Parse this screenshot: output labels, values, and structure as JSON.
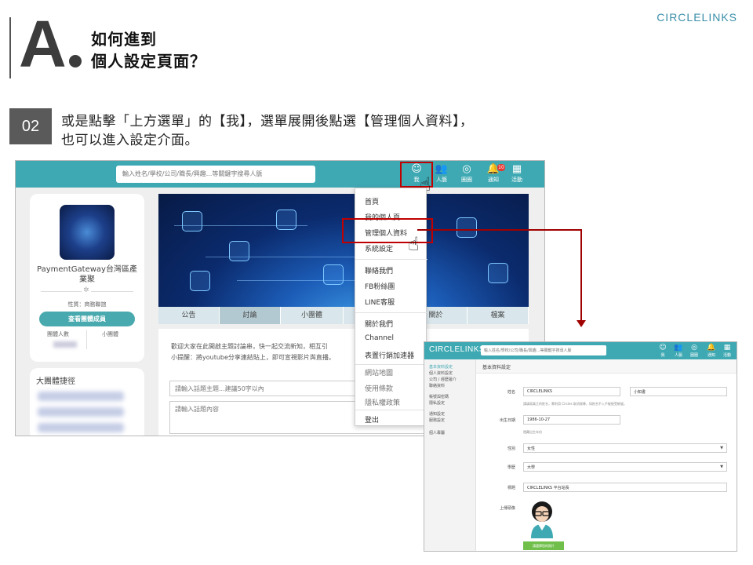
{
  "header": {
    "letter": "A",
    "title_line1": "如何進到",
    "title_line2": "個人設定頁面？",
    "brand": "CIRCLELINKS"
  },
  "step": {
    "number": "02",
    "line1": "或是點擊「上方選單」的【我】，選單展開後點選【管理個人資料】，",
    "line2": "也可以進入設定介面。"
  },
  "screen1": {
    "search_placeholder": "輸入姓名/學校/公司/職長/興趣...等關鍵字搜尋人脈",
    "nav": [
      {
        "label": "我",
        "icon": "avatar-icon"
      },
      {
        "label": "人脈",
        "icon": "people-icon"
      },
      {
        "label": "圈圈",
        "icon": "circles-icon"
      },
      {
        "label": "通知",
        "icon": "bell-icon",
        "badge": "10"
      },
      {
        "label": "活動",
        "icon": "calendar-icon"
      }
    ],
    "profile": {
      "name": "PaymentGateway台灣區產業聚",
      "status": "性質：商務聯誼",
      "button": "查看團體成員",
      "stat1_label": "團體人數",
      "stat2_label": "小團體"
    },
    "shortcut_title": "大團體捷徑",
    "tabs": [
      "公告",
      "討論",
      "小團體",
      "",
      "關於",
      "檔案"
    ],
    "post": {
      "desc_line1": "歡迎大家在此開啟主題討論串，快一起交流新知，相互引",
      "desc_line2": "小提醒：將youtube分享連結貼上，即可宣視影片與直播。",
      "title_placeholder": "請輸入話題主題...建議50字以內",
      "body_placeholder": "請輸入話題內容"
    },
    "dropdown": {
      "group1": [
        "首頁",
        "我的個人頁",
        "管理個人資料",
        "系統設定"
      ],
      "group2": [
        "聯絡我們",
        "FB粉絲團",
        "LINE客服"
      ],
      "group3": [
        "關於我們",
        "Channel",
        "表置行銷加速器"
      ],
      "group4": [
        "網站地圖",
        "使用條款",
        "隱私權政策"
      ],
      "group5": [
        "登出"
      ]
    }
  },
  "screen2": {
    "logo": "CIRCLELINKS",
    "search_placeholder": "輸入姓名/學校/公司/職長/興趣...等關鍵字搜尋人脈",
    "nav": [
      "我",
      "人脈",
      "圈圈",
      "通知",
      "活動"
    ],
    "sidebar": [
      "基本資料設定",
      "個人資料設定",
      "公司 / 經歷履介",
      "聯絡資料",
      "帳號與密碼",
      "隱私設定",
      "通知設定",
      "服務設定",
      "個人專屬"
    ],
    "section_title": "基本資料設定",
    "fields": {
      "name_label": "姓名",
      "name_value": "CIRCLELINKS",
      "nickname_value": "小知書",
      "name_hint": "請填寫真正的姓名，需利用 Circles 取消搜尋，如姓名不入不能接受帳號。",
      "birth_label": "出生日期",
      "birth_value": "1986-10-27",
      "birth_hint": "隱藏出生年份",
      "gender_label": "性別",
      "gender_value": "女性",
      "edu_label": "學歷",
      "edu_value": "大學",
      "headline_label": "標題",
      "headline_value": "CIRCLELINKS 平台站長",
      "photo_label": "上傳頭像",
      "upload_button": "請選擇您的照片"
    }
  }
}
